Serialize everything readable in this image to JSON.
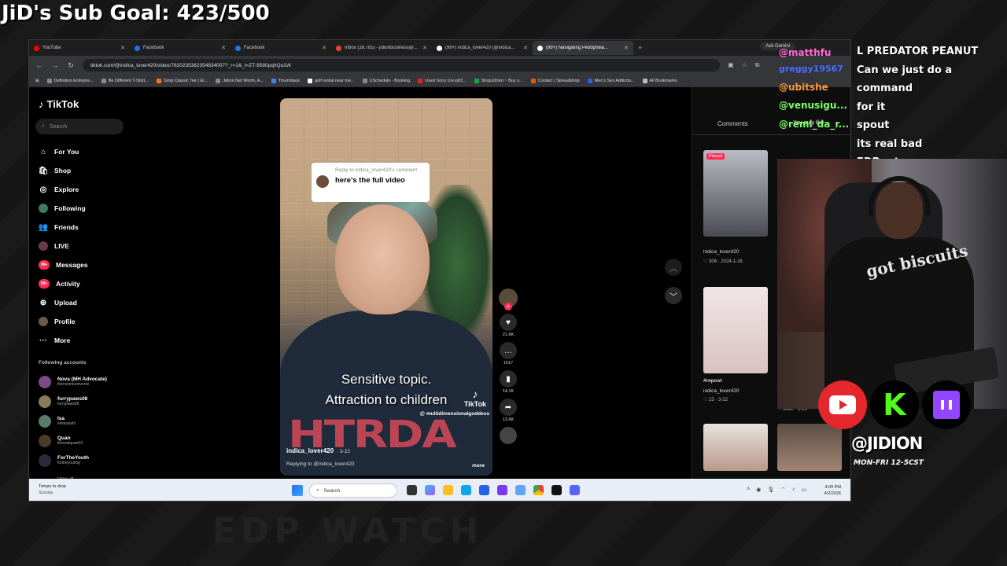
{
  "overlay": {
    "sub_goal": "JiD's Sub Goal: 423/500",
    "handle": "@JIDION",
    "schedule": "MON-FRI 12-5CST",
    "watermark": "EDP WATCH"
  },
  "chat": {
    "names": [
      "@matthfu",
      "greggy19567",
      "@ubitshe",
      "@venusigu...",
      "@remi_da_r..."
    ],
    "messages": [
      "L PREDATOR PEANUT",
      "Can we just do a command",
      "for it",
      "spout",
      "its real bad",
      "EDPnut"
    ]
  },
  "browser": {
    "tabs": [
      {
        "label": "YouTube",
        "color": "#ff0000"
      },
      {
        "label": "Facebook",
        "color": "#1877f2"
      },
      {
        "label": "Facebook",
        "color": "#1877f2"
      },
      {
        "label": "Inbox (39,785) - jidionbusiness@...",
        "color": "#ea4335"
      },
      {
        "label": "(99+) indica_lover420 (@indica...",
        "color": "#ffffff"
      },
      {
        "label": "(99+) Navigating Pedophilia...",
        "color": "#ffffff"
      }
    ],
    "gemini": "Ask Gemini",
    "url": "tiktok.com/@indica_lover420/video/7620235382354834007?_r=1&_t=ZT-9580pqhQa1W",
    "bookmarks": [
      "Definition Entrepre...",
      "Be Different T-Shirt...",
      "Simp Classic Tee | Et...",
      "Jidion Net Worth, A...",
      "Thumbtack",
      "golf rental near me...",
      "USchedule - Booking",
      "Used Sony Urx-p03...",
      "ShopJiDion ~ Buy s...",
      "Contact | Spreadshop",
      "Men's Sex Addictio...",
      "All Bookmarks"
    ]
  },
  "tiktok": {
    "brand": "TikTok",
    "search_placeholder": "Search",
    "nav": [
      {
        "label": "For You",
        "icon": "home-icon"
      },
      {
        "label": "Shop",
        "icon": "shop-icon"
      },
      {
        "label": "Explore",
        "icon": "compass-icon"
      },
      {
        "label": "Following",
        "icon": "avatar-icon"
      },
      {
        "label": "Friends",
        "icon": "friends-icon"
      },
      {
        "label": "LIVE",
        "icon": "live-icon"
      },
      {
        "label": "Messages",
        "icon": "messages-icon",
        "badge": "99+"
      },
      {
        "label": "Activity",
        "icon": "activity-icon",
        "badge": "99+"
      },
      {
        "label": "Upload",
        "icon": "upload-icon"
      },
      {
        "label": "Profile",
        "icon": "profile-icon"
      },
      {
        "label": "More",
        "icon": "more-icon"
      }
    ],
    "following_title": "Following accounts",
    "accounts": [
      {
        "name": "Nova (MH Advocate)",
        "handle": "thenovineuniverse"
      },
      {
        "name": "furrypaws08",
        "handle": "furrypaws08"
      },
      {
        "name": "Isa",
        "handle": "whoisisahi"
      },
      {
        "name": "Quan",
        "handle": "therealquan03"
      },
      {
        "name": "ForTheYouth",
        "handle": "fortheyouthig"
      }
    ],
    "view_all": "View all",
    "video": {
      "reply_to": "Reply to indica_lover420's comment",
      "reply_text": "here's the full video",
      "caption_line1": "Sensitive topic.",
      "caption_line2": "Attraction to children",
      "watermark": "TikTok",
      "watermark_handle": "@ multidimensionalgoddess",
      "username": "indica_lover420",
      "date": "· 3-22",
      "replying": "Replying to @indica_lover420",
      "more": "more",
      "shirt_print": "HTRDA"
    },
    "actions": {
      "likes": "21.6K",
      "comments": "1617",
      "saves": "14.1K",
      "shares": "13.6K"
    },
    "right": {
      "comments_tab": "Comments",
      "may_like": "You may like",
      "pinned": "Pinned",
      "items": [
        {
          "user": "indica_lover420",
          "meta": "♡ 306 · 2024-1-16"
        },
        {
          "title": "#repost",
          "user": "indica_lover420",
          "meta": "♡ 23 · 3-22"
        },
        {
          "user": "indica_lover420",
          "meta": "♡ 9821 · 3-19"
        }
      ]
    }
  },
  "taskbar": {
    "weather_line1": "Temps to drop",
    "weather_line2": "Sunday",
    "search": "Search",
    "time": "4:09 PM",
    "date": "4/2/2026"
  },
  "webcam": {
    "shirt_text": "got biscuits"
  }
}
